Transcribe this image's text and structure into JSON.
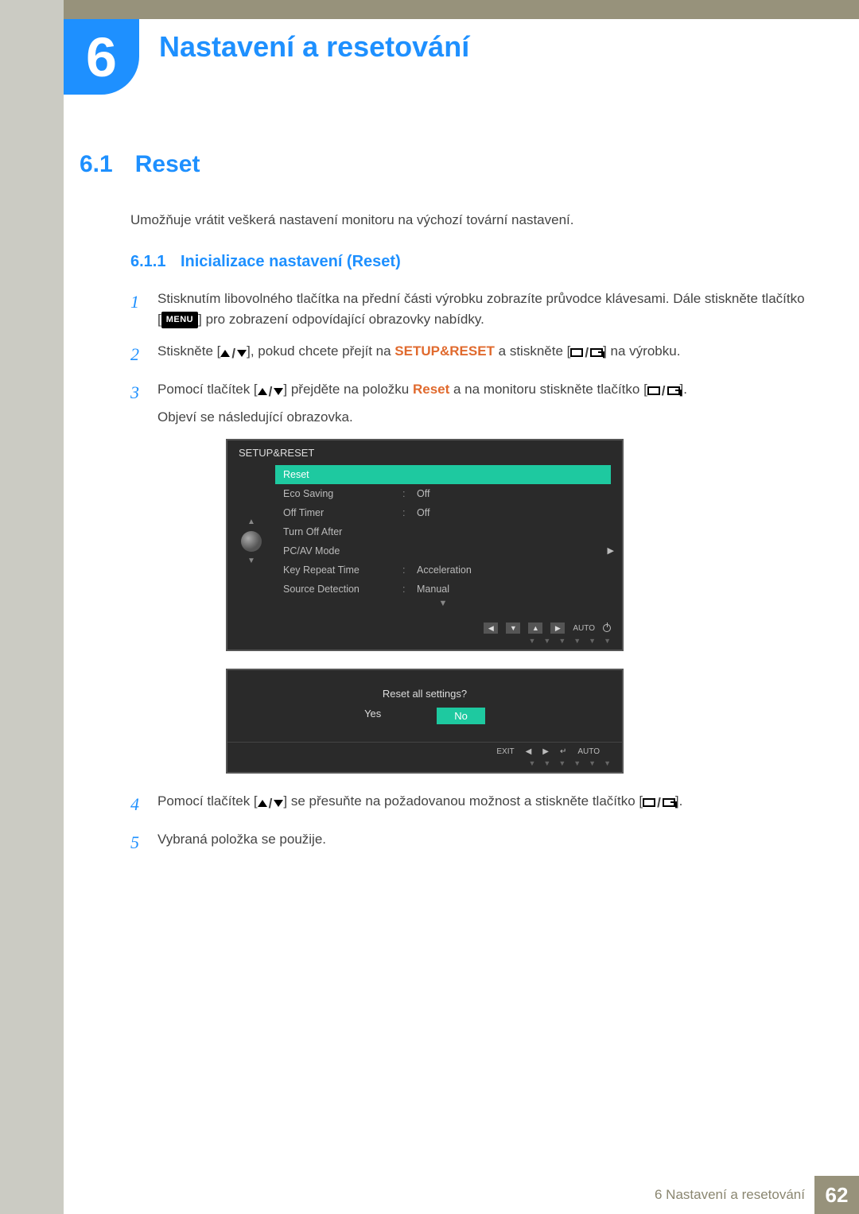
{
  "chapter": {
    "number": "6",
    "title": "Nastavení a resetování"
  },
  "section": {
    "number": "6.1",
    "title": "Reset"
  },
  "intro": "Umožňuje vrátit veškerá nastavení monitoru na výchozí tovární nastavení.",
  "subsection": {
    "number": "6.1.1",
    "title": "Inicializace nastavení (Reset)"
  },
  "menu_badge": "MENU",
  "setup_reset_kw": "SETUP&RESET",
  "reset_kw": "Reset",
  "steps": {
    "s1_a": "Stisknutím libovolného tlačítka na přední části výrobku zobrazíte průvodce klávesami. Dále stiskněte tlačítko [",
    "s1_b": "] pro zobrazení odpovídající obrazovky nabídky.",
    "s2_a": "Stiskněte [",
    "s2_b": "], pokud chcete přejít na ",
    "s2_c": " a stiskněte [",
    "s2_d": "] na výrobku.",
    "s3_a": "Pomocí tlačítek [",
    "s3_b": "] přejděte na položku ",
    "s3_c": " a na monitoru stiskněte tlačítko [",
    "s3_d": "].",
    "s3_e": "Objeví se následující obrazovka.",
    "s4_a": "Pomocí tlačítek [",
    "s4_b": "] se přesuňte na požadovanou možnost a stiskněte tlačítko [",
    "s4_c": "].",
    "s5": "Vybraná položka se použije."
  },
  "osd1": {
    "title": "SETUP&RESET",
    "rows": [
      {
        "label": "Reset",
        "val": "",
        "sel": true
      },
      {
        "label": "Eco Saving",
        "val": "Off"
      },
      {
        "label": "Off Timer",
        "val": "Off"
      },
      {
        "label": "Turn Off After",
        "val": ""
      },
      {
        "label": "PC/AV Mode",
        "val": ""
      },
      {
        "label": "Key Repeat Time",
        "val": "Acceleration"
      },
      {
        "label": "Source Detection",
        "val": "Manual"
      }
    ],
    "nav_auto": "AUTO"
  },
  "osd2": {
    "question": "Reset all settings?",
    "yes": "Yes",
    "no": "No",
    "exit": "EXIT",
    "auto": "AUTO"
  },
  "footer": {
    "text": "6 Nastavení a resetování",
    "page": "62"
  }
}
